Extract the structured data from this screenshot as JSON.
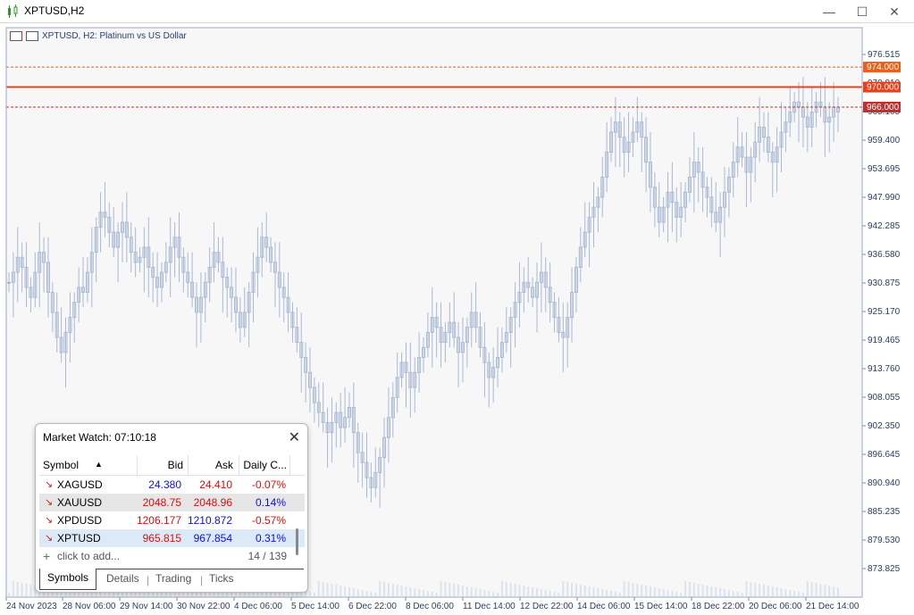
{
  "window": {
    "title": "XPTUSD,H2",
    "min_icon": "minimize-icon",
    "max_icon": "maximize-icon",
    "close_icon": "close-icon"
  },
  "chart_header": {
    "text": "XPTUSD, H2:  Platinum vs US Dollar"
  },
  "chart_data": {
    "type": "line",
    "symbol": "XPTUSD",
    "timeframe": "H2",
    "ylim": [
      870.0,
      980.0
    ],
    "y_ticks": [
      "976.515",
      "970.810",
      "965.105",
      "959.400",
      "953.695",
      "947.990",
      "942.285",
      "936.580",
      "930.875",
      "925.170",
      "919.465",
      "913.760",
      "908.055",
      "902.350",
      "896.645",
      "890.940",
      "885.235",
      "879.530",
      "873.825"
    ],
    "x_ticks": [
      "24 Nov 2023",
      "28 Nov 06:00",
      "29 Nov 14:00",
      "30 Nov 22:00",
      "4 Dec 06:00",
      "5 Dec 14:00",
      "6 Dec 22:00",
      "8 Dec 06:00",
      "11 Dec 14:00",
      "12 Dec 22:00",
      "14 Dec 06:00",
      "15 Dec 14:00",
      "18 Dec 22:00",
      "20 Dec 06:00",
      "21 Dec 14:00"
    ],
    "level_lines": [
      {
        "label": "974.000",
        "value": 974.0,
        "style": "dashed",
        "color": "#e8601c"
      },
      {
        "label": "970.000",
        "value": 970.0,
        "style": "solid",
        "color": "#e8401c"
      },
      {
        "label": "966.000",
        "value": 966.0,
        "style": "dashed",
        "color": "#c03030"
      }
    ],
    "close_series": [
      931,
      933,
      936,
      934,
      930,
      928,
      933,
      937,
      935,
      929,
      925,
      920,
      917,
      921,
      924,
      927,
      930,
      929,
      933,
      937,
      942,
      945,
      944,
      941,
      938,
      941,
      943,
      940,
      937,
      935,
      936,
      938,
      934,
      932,
      930,
      933,
      935,
      938,
      940,
      936,
      933,
      931,
      928,
      925,
      928,
      931,
      934,
      937,
      935,
      932,
      930,
      928,
      925,
      922,
      925,
      929,
      933,
      936,
      940,
      938,
      935,
      933,
      930,
      928,
      925,
      922,
      919,
      916,
      913,
      910,
      907,
      905,
      903,
      901,
      903,
      905,
      902,
      904,
      906,
      901,
      897,
      895,
      892,
      890,
      893,
      896,
      900,
      904,
      908,
      912,
      915,
      913,
      910,
      913,
      916,
      918,
      921,
      924,
      922,
      919,
      921,
      923,
      920,
      917,
      919,
      922,
      925,
      922,
      918,
      915,
      912,
      914,
      916,
      919,
      921,
      924,
      927,
      929,
      931,
      930,
      928,
      931,
      933,
      930,
      927,
      924,
      921,
      920,
      924,
      929,
      934,
      938,
      941,
      944,
      946,
      948,
      952,
      957,
      961,
      963,
      960,
      957,
      959,
      961,
      963,
      960,
      955,
      950,
      946,
      943,
      946,
      949,
      947,
      944,
      946,
      949,
      952,
      955,
      953,
      950,
      948,
      945,
      943,
      946,
      949,
      952,
      955,
      958,
      956,
      953,
      956,
      959,
      962,
      960,
      957,
      955,
      958,
      961,
      963,
      965,
      967,
      966,
      964,
      962,
      965,
      967,
      966,
      963,
      964,
      966,
      965
    ]
  },
  "market_watch": {
    "title": "Market Watch: 07:10:18",
    "columns": [
      "Symbol",
      "Bid",
      "Ask",
      "Daily C..."
    ],
    "rows": [
      {
        "symbol": "XAGUSD",
        "bid": "24.380",
        "ask": "24.410",
        "change": "-0.07%"
      },
      {
        "symbol": "XAUUSD",
        "bid": "2048.75",
        "ask": "2048.96",
        "change": "0.14%"
      },
      {
        "symbol": "XPDUSD",
        "bid": "1206.177",
        "ask": "1210.872",
        "change": "-0.57%"
      },
      {
        "symbol": "XPTUSD",
        "bid": "965.815",
        "ask": "967.854",
        "change": "0.31%"
      }
    ],
    "add_label": "click to add...",
    "count": "14 / 139",
    "tabs": [
      "Symbols",
      "Details",
      "Trading",
      "Ticks"
    ]
  },
  "colors": {
    "bid_up": "#1010d0",
    "ask_down": "#d01010",
    "candle": "#a9b9d4",
    "axis_text": "#2a3e66"
  }
}
